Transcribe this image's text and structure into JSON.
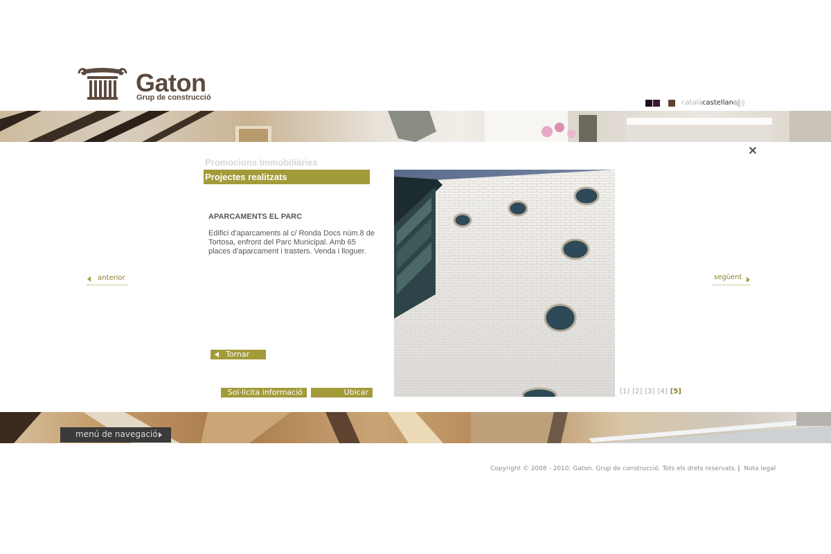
{
  "brand": {
    "name": "Gaton",
    "tagline": "Grup de construcció",
    "color": "#5b4a3f"
  },
  "header": {
    "swatches": [
      "#1a0f1c",
      "#3b1530",
      "#5a4630"
    ],
    "languages": [
      "català",
      "castellano"
    ],
    "sound_icon": "speaker-icon"
  },
  "content": {
    "section_inactive": "Promocions Immobiliàries",
    "section_active": "Projectes realitzats",
    "project_title": "APARCAMENTS EL PARC",
    "project_description": "Edifici d'aparcaments al c/ Ronda Docs núm.8 de Tortosa, enfront del Parc Municipal. Amb 65 places d'aparcament i trasters. Venda i lloguer.",
    "back_label": "Tornar",
    "info_label": "Sol·licita informació",
    "locate_label": "Ubicar",
    "accent": "#a39a3a"
  },
  "gallery": {
    "pages": [
      "[1]",
      "[2]",
      "[3]",
      "[4]",
      "[5]"
    ],
    "current_page": 5
  },
  "navigation": {
    "prev_label": "anterior",
    "next_label": "següent",
    "close_label": "✕",
    "menu_label": "menú de navegació"
  },
  "footer": {
    "copyright": "Copyright © 2008 - 2010. Gaton. Grup de construcció. Tots els drets reservats.",
    "legal_link": "Nota legal"
  }
}
